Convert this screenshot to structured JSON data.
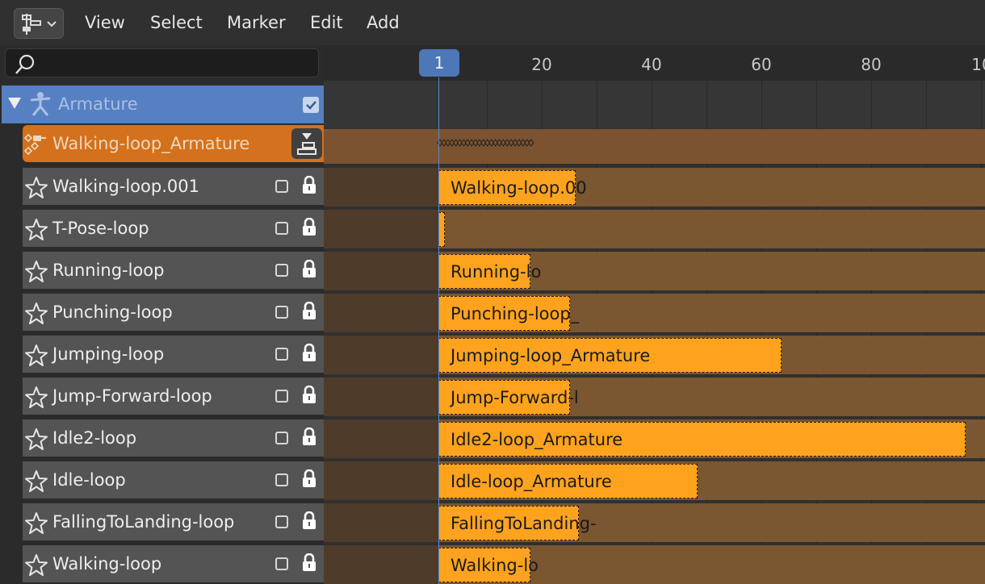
{
  "menu": {
    "editor_icon": "nla-editor-icon",
    "items": [
      "View",
      "Select",
      "Marker",
      "Edit",
      "Add"
    ]
  },
  "search": {
    "value": "",
    "placeholder": ""
  },
  "armature": {
    "label": "Armature",
    "checked": true
  },
  "active_action": {
    "label": "Walking-loop_Armature"
  },
  "tracks": [
    {
      "label": "Walking-loop.001",
      "strip": "Walking-loop.00"
    },
    {
      "label": "T-Pose-loop",
      "strip": ""
    },
    {
      "label": "Running-loop",
      "strip": "Running-lo"
    },
    {
      "label": "Punching-loop",
      "strip": "Punching-loop_"
    },
    {
      "label": "Jumping-loop",
      "strip": "Jumping-loop_Armature"
    },
    {
      "label": "Jump-Forward-loop",
      "strip": "Jump-Forward-l"
    },
    {
      "label": "Idle2-loop",
      "strip": "Idle2-loop_Armature"
    },
    {
      "label": "Idle-loop",
      "strip": "Idle-loop_Armature"
    },
    {
      "label": "FallingToLanding-loop",
      "strip": "FallingToLanding-"
    },
    {
      "label": "Walking-loop",
      "strip": "Walking-lo"
    }
  ],
  "timeline": {
    "current_frame": "1",
    "ticks": [
      "20",
      "40",
      "60",
      "80",
      "10"
    ]
  },
  "colors": {
    "strip": "#ffa31f",
    "action_row": "#d4711c",
    "selected_row": "#5680c2",
    "playhead": "#5b86c8"
  }
}
